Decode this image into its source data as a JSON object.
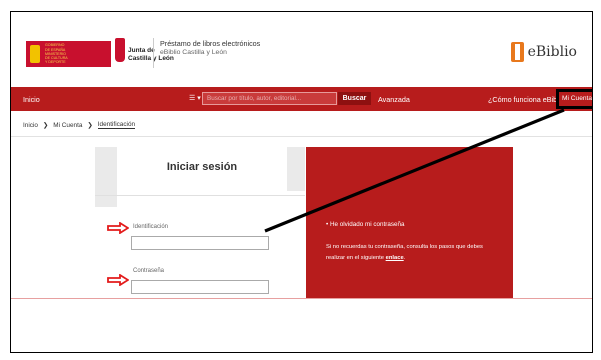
{
  "header": {
    "gov_logo_text": "GOBIERNO\nDE ESPAÑA   MINISTERIO\nDE CULTURA\nY DEPORTE",
    "region_logo_text": "Junta de\nCastilla y León",
    "title": "Préstamo de libros electrónicos",
    "subtitle": "eBiblio Castilla y León",
    "brand": "eBiblio"
  },
  "navbar": {
    "home": "Inicio",
    "menu_icon": "☰ ▾",
    "search_placeholder": "Buscar por título, autor, editorial...",
    "search_button": "Buscar",
    "advanced": "Avanzada",
    "how_it_works": "¿Cómo funciona eBiblio?",
    "account": "Mi Cuenta"
  },
  "breadcrumb": {
    "items": [
      "Inicio",
      "Mi Cuenta",
      "Identificación"
    ],
    "separator": "❯"
  },
  "login": {
    "title": "Iniciar sesión",
    "id_label": "Identificación",
    "password_label": "Contraseña"
  },
  "help": {
    "forgot": "•  He olvidado mi contraseña",
    "text_line1": "Si no recuerdas tu contraseña, consulta los pasos que debes",
    "text_line2_prefix": "realizar en el siguiente ",
    "text_link": "enlace",
    "text_end": "."
  },
  "colors": {
    "brand_red": "#b71c1c",
    "arrow_red": "#e31b1b",
    "ebiblio_orange": "#e8781c"
  },
  "icons": [
    "menu-icon",
    "chevron-icon",
    "arrow-right-icon",
    "book-icon"
  ]
}
